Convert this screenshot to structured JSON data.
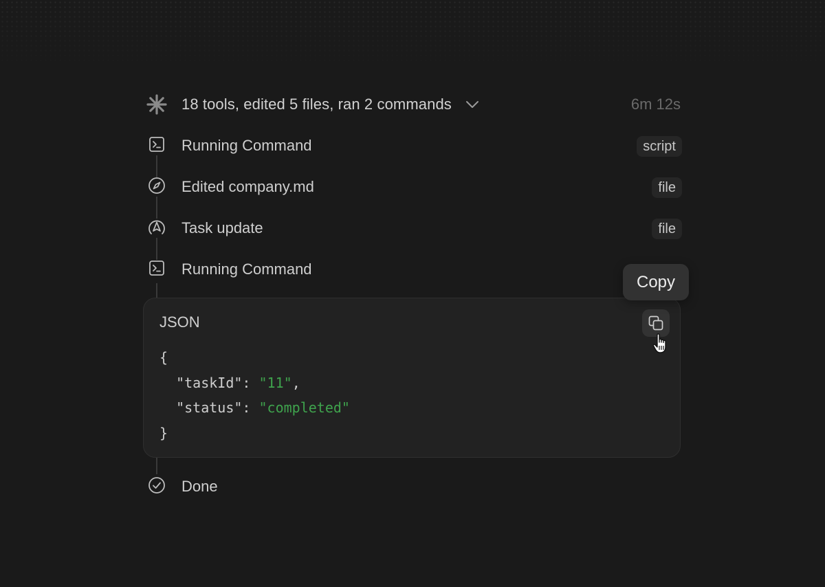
{
  "summary": {
    "text": "18 tools, edited 5 files, ran 2 commands",
    "elapsed": "6m 12s"
  },
  "steps": [
    {
      "label": "Running Command",
      "tag": "script",
      "icon": "terminal-icon"
    },
    {
      "label": "Edited company.md",
      "tag": "file",
      "icon": "compass-icon"
    },
    {
      "label": "Task update",
      "tag": "file",
      "icon": "navigation-arrow-icon"
    },
    {
      "label": "Running Command",
      "tag": "",
      "icon": "terminal-icon"
    }
  ],
  "code_panel": {
    "language": "JSON",
    "lines": {
      "open": "{",
      "key1": "\"taskId\"",
      "val1": "\"11\"",
      "key2": "\"status\"",
      "val2": "\"completed\"",
      "close": "}"
    },
    "tooltip": "Copy"
  },
  "done": {
    "label": "Done",
    "icon": "check-circle-icon"
  },
  "colors": {
    "background": "#1a1a1a",
    "panel": "#222222",
    "string": "#3fa34d",
    "muted": "#6a6a6a"
  }
}
